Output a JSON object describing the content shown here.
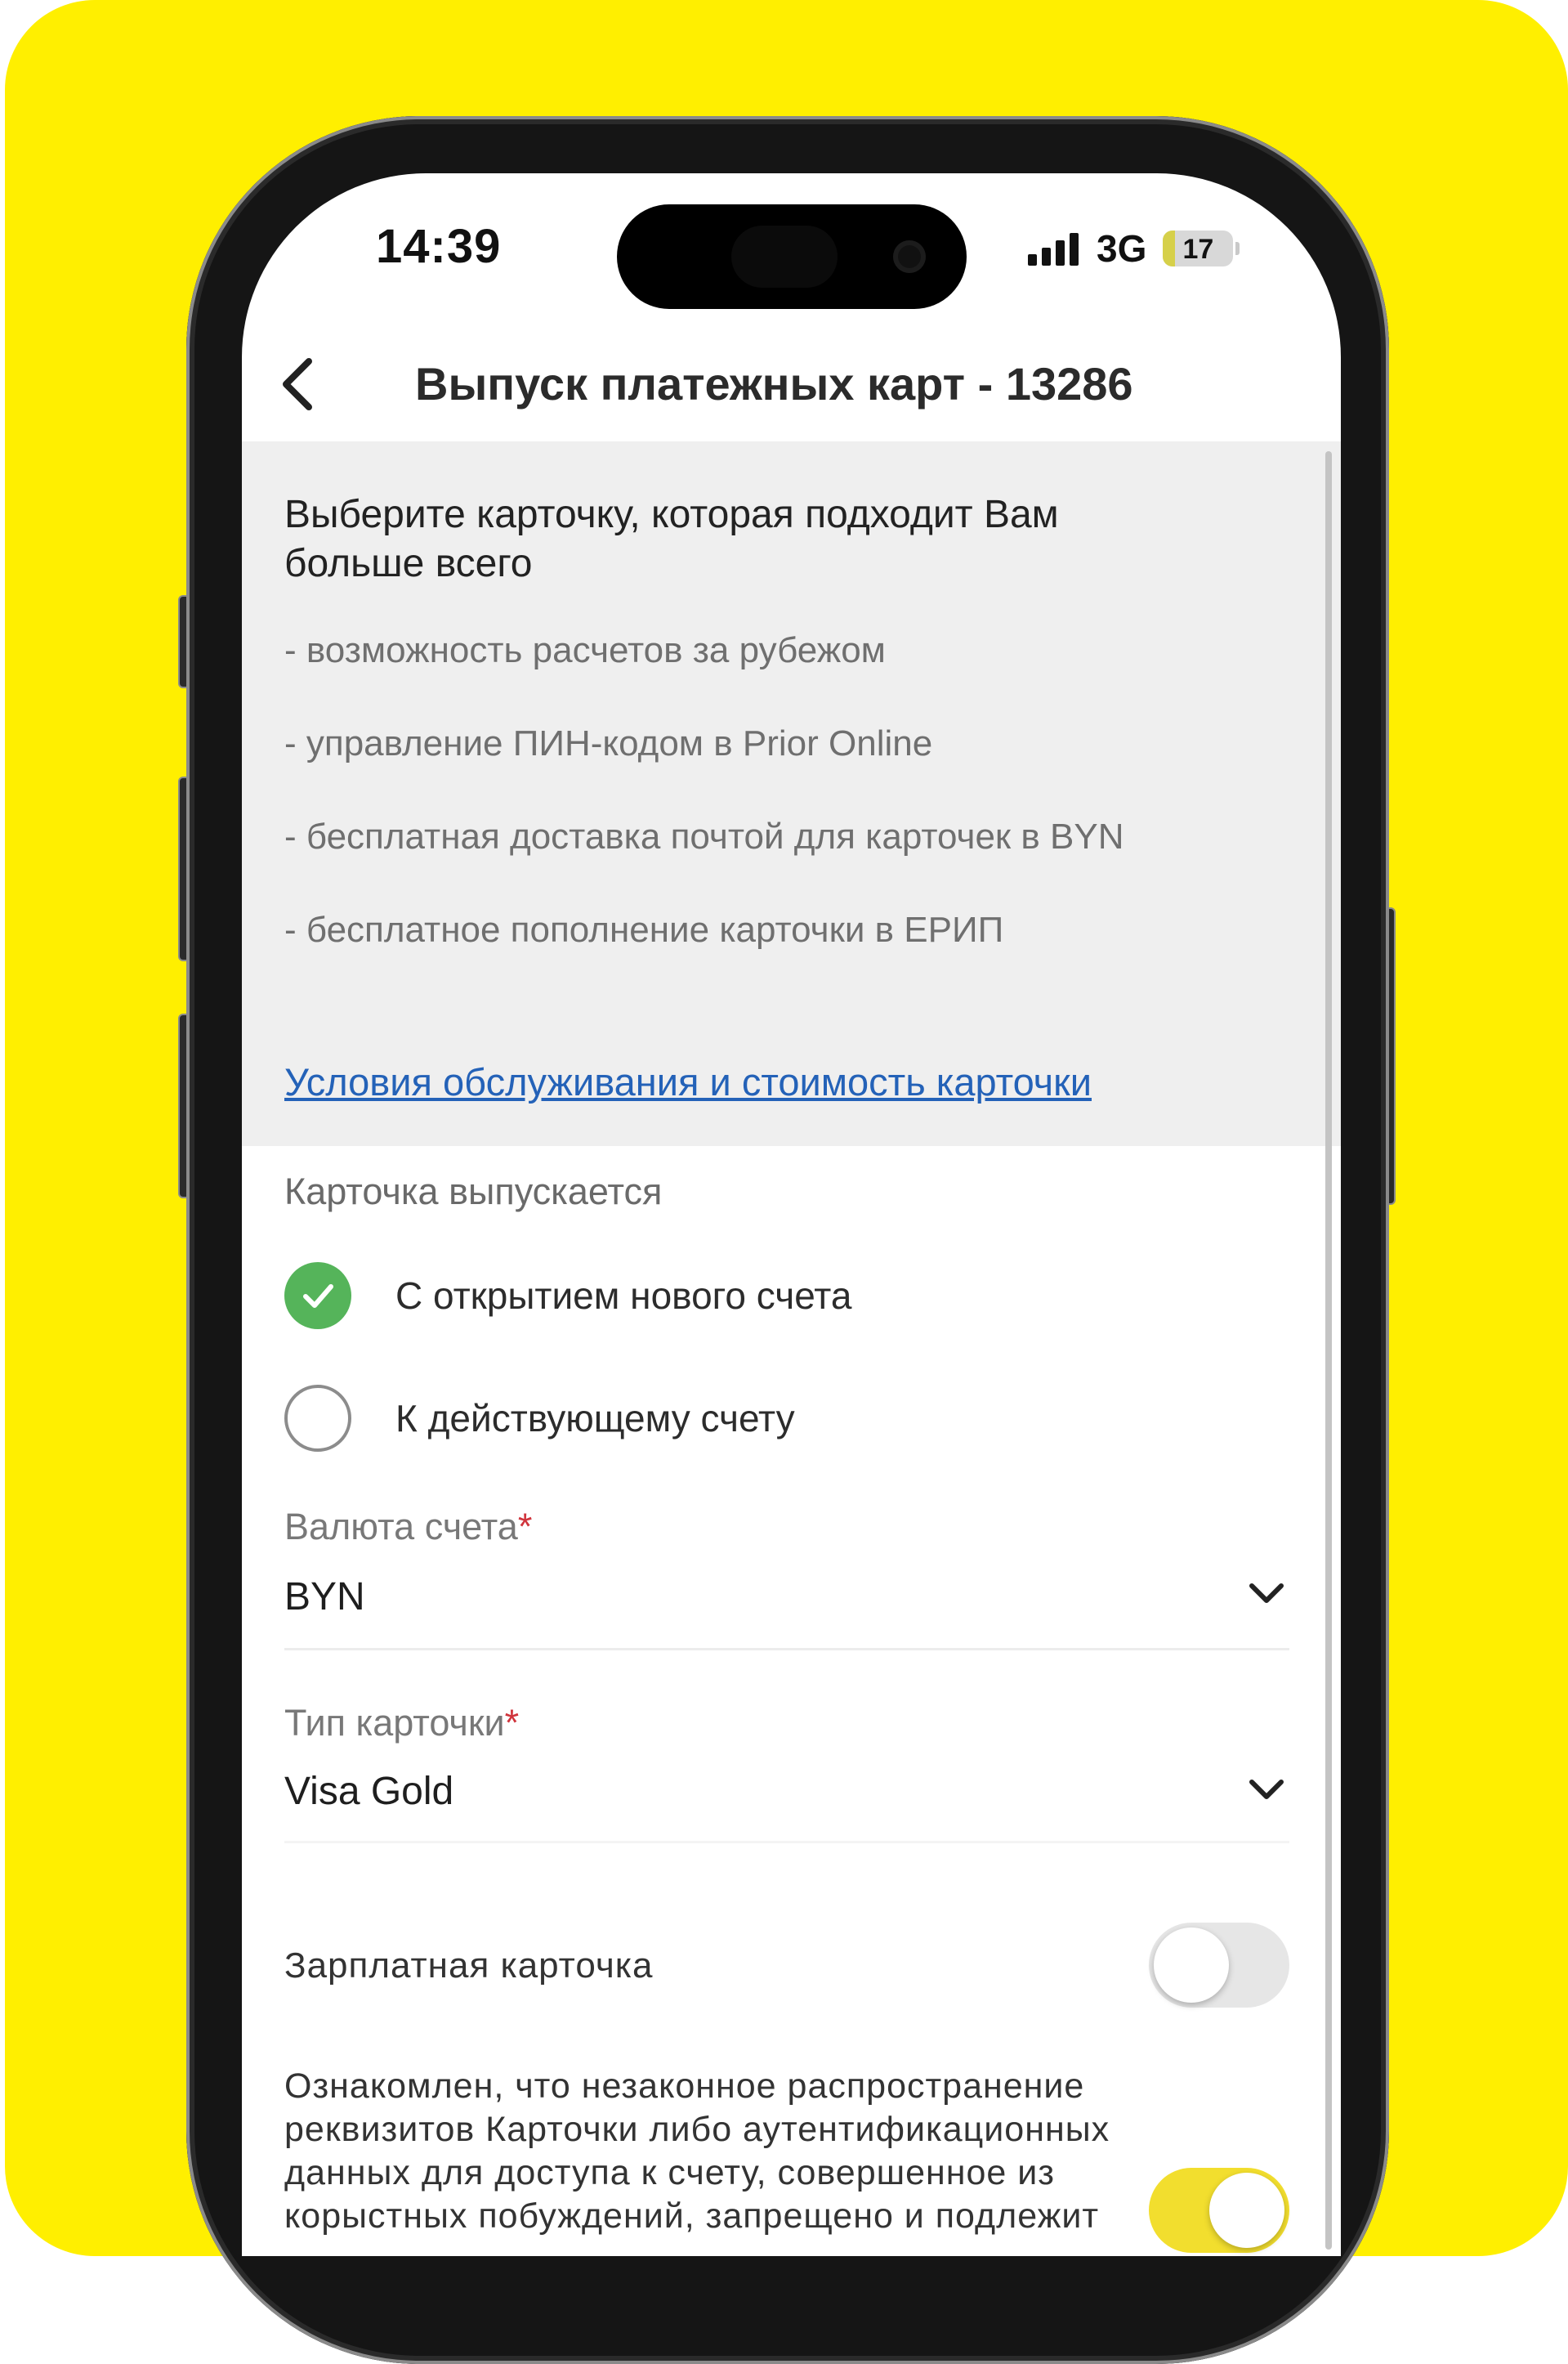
{
  "status_bar": {
    "time": "14:39",
    "network": "3G",
    "battery": "17",
    "battery_level": 0.17,
    "battery_color": "#D6D04A"
  },
  "header": {
    "title": "Выпуск платежных карт - 13286",
    "back_icon": "chevron-left-icon"
  },
  "info_panel": {
    "heading": "Выберите карточку, которая подходит Вам больше всего",
    "features": [
      "- возможность расчетов за рубежом",
      "- управление ПИН-кодом в Prior Online",
      "- бесплатная доставка почтой для карточек в BYN",
      "- бесплатное пополнение карточки в ЕРИП"
    ],
    "link": "Условия обслуживания и стоимость карточки",
    "link_color": "#2462B8"
  },
  "issue_options": {
    "label": "Карточка выпускается",
    "options": [
      {
        "label": "С открытием нового счета",
        "selected": true
      },
      {
        "label": "К действующему счету",
        "selected": false
      }
    ],
    "selected_color": "#55B45A"
  },
  "currency_field": {
    "label": "Валюта счета",
    "required_mark": "*",
    "value": "BYN",
    "icon": "chevron-down-icon"
  },
  "card_type_field": {
    "label": "Тип карточки",
    "required_mark": "*",
    "value": "Visa Gold",
    "icon": "chevron-down-icon"
  },
  "salary_card": {
    "label": "Зарплатная карточка",
    "enabled": false
  },
  "consent": {
    "text": "Ознакомлен, что незаконное распространение реквизитов Карточки либо аутентификационных данных для доступа к счету, совершенное из корыстных побуждений, запрещено и подлежит",
    "enabled": true,
    "on_color": "#F2DE2E"
  },
  "colors": {
    "background": "#FFEF00",
    "info_panel": "#efefef",
    "required": "#D0343C"
  }
}
